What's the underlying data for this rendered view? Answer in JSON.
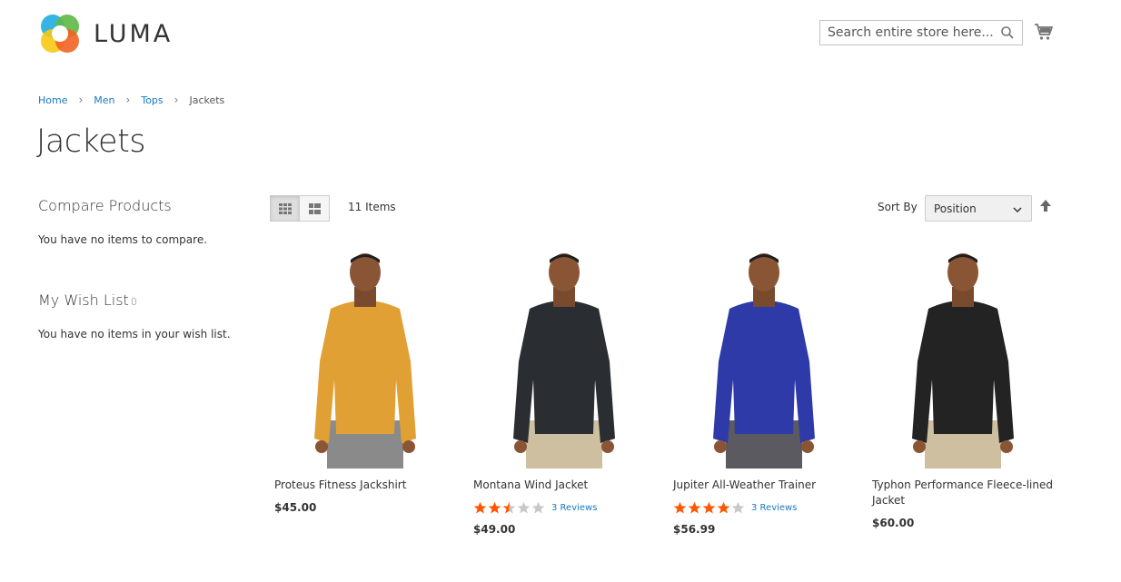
{
  "brand": {
    "name": "LUMA"
  },
  "search": {
    "placeholder": "Search entire store here..."
  },
  "breadcrumb": [
    {
      "label": "Home"
    },
    {
      "label": "Men"
    },
    {
      "label": "Tops"
    },
    {
      "label": "Jackets"
    }
  ],
  "page": {
    "title": "Jackets"
  },
  "sidebar": {
    "compare": {
      "title": "Compare Products",
      "empty": "You have no items to compare."
    },
    "wishlist": {
      "title": "My Wish List",
      "count": "0",
      "empty": "You have no items in your wish list."
    }
  },
  "toolbar": {
    "items_count": "11 Items",
    "sort_label": "Sort By",
    "sort_value": "Position",
    "view_modes": [
      "grid",
      "list"
    ]
  },
  "products": [
    {
      "name": "Proteus Fitness Jackshirt",
      "price": "$45.00",
      "rating": null,
      "reviews": null,
      "jacket_color": "#e0a034"
    },
    {
      "name": "Montana Wind Jacket",
      "price": "$49.00",
      "rating": 2.5,
      "reviews": "3  Reviews",
      "jacket_color": "#2a2d31"
    },
    {
      "name": "Jupiter All-Weather Trainer",
      "price": "$56.99",
      "rating": 4,
      "reviews": "3  Reviews",
      "jacket_color": "#2e3aa8"
    },
    {
      "name": "Typhon Performance Fleece-lined Jacket",
      "price": "$60.00",
      "rating": null,
      "reviews": null,
      "jacket_color": "#232323"
    }
  ],
  "colors": {
    "link": "#1979c3",
    "star": "#ff5501",
    "star_empty": "#c7c7c7"
  }
}
